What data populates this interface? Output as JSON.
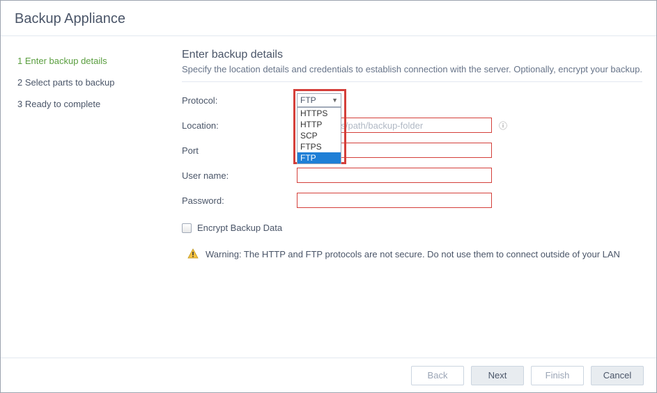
{
  "header": {
    "title": "Backup Appliance"
  },
  "sidebar": {
    "steps": [
      {
        "num": "1",
        "label": "Enter backup details",
        "active": true
      },
      {
        "num": "2",
        "label": "Select parts to backup",
        "active": false
      },
      {
        "num": "3",
        "label": "Ready to complete",
        "active": false
      }
    ]
  },
  "content": {
    "title": "Enter backup details",
    "subtitle": "Specify the location details and credentials to establish connection with the server. Optionally, encrypt your backup."
  },
  "form": {
    "protocol": {
      "label": "Protocol:",
      "value": "FTP",
      "options": [
        "HTTPS",
        "HTTP",
        "SCP",
        "FTPS",
        "FTP"
      ]
    },
    "location": {
      "label": "Location:",
      "placeholder": "IP-address/path/backup-folder",
      "value": ""
    },
    "port": {
      "label": "Port",
      "value": ""
    },
    "username": {
      "label": "User name:",
      "value": ""
    },
    "password": {
      "label": "Password:",
      "value": ""
    },
    "encrypt": {
      "label": "Encrypt Backup Data"
    },
    "warning": "Warning: The HTTP and FTP protocols are not secure. Do not use them to connect outside of your LAN"
  },
  "footer": {
    "back": "Back",
    "next": "Next",
    "finish": "Finish",
    "cancel": "Cancel"
  }
}
